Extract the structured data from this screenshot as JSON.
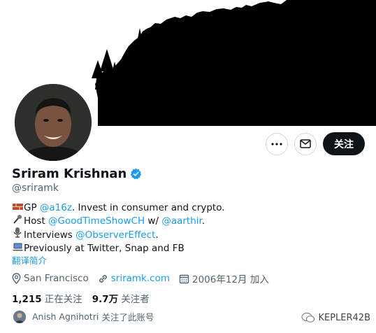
{
  "profile": {
    "name": "Sriram Krishnan",
    "handle": "@sriramk",
    "verified": true
  },
  "actions": {
    "follow_label": "关注"
  },
  "bio": {
    "line1": {
      "emoji": "brick",
      "prefix": "GP ",
      "mention": "@a16z",
      "suffix": ". Invest in consumer and crypto."
    },
    "line2": {
      "emoji": "microphone",
      "prefix": "Host ",
      "mention1": "@GoodTimeShowCH",
      "middle": " w/ ",
      "mention2": "@aarthir",
      "suffix": "."
    },
    "line3": {
      "emoji": "studio-microphone",
      "prefix": "Interviews ",
      "mention": "@ObserverEffect",
      "suffix": "."
    },
    "line4": {
      "emoji": "laptop",
      "text": "Previously at Twitter, Snap and FB"
    }
  },
  "translate_label": "翻译简介",
  "meta": {
    "location": "San Francisco",
    "website": "sriramk.com",
    "joined": "2006年12月 加入"
  },
  "stats": {
    "following_count": "1,215",
    "following_label": "正在关注",
    "followers_count": "9.7万",
    "followers_label": "关注者"
  },
  "followed_by": {
    "name": "Anish Agnihotri",
    "text": "关注了此账号"
  },
  "watermark": {
    "text": "KEPLER42B"
  },
  "colors": {
    "accent": "#1d9bf0",
    "text": "#0f1419",
    "muted": "#536471",
    "button_bg": "#0f1419"
  }
}
